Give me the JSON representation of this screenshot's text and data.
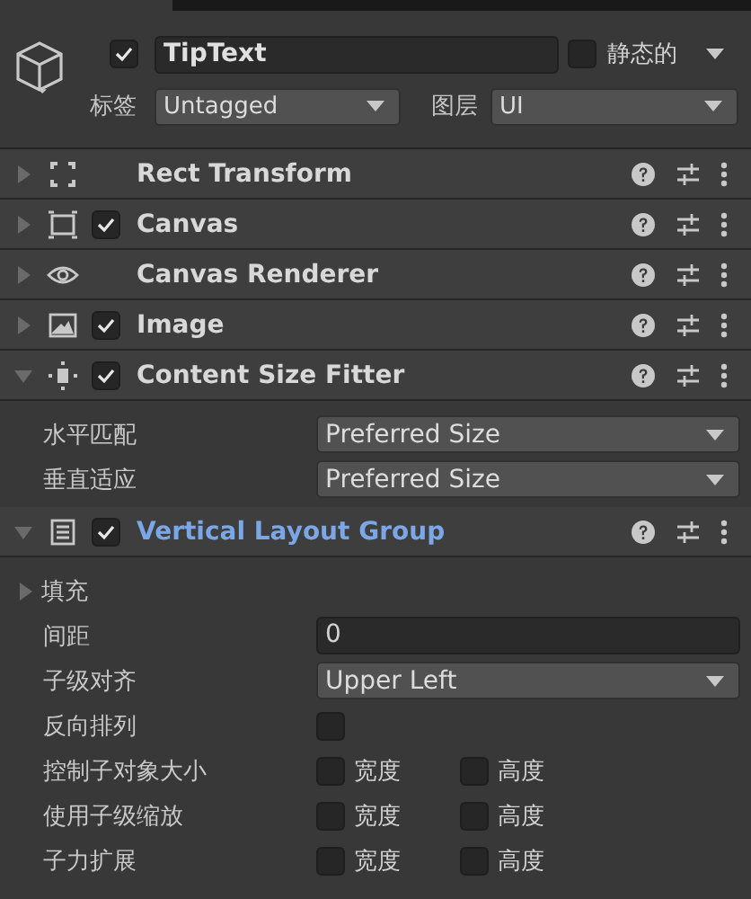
{
  "object": {
    "active": true,
    "name": "TipText",
    "static": false,
    "static_label": "静态的",
    "tag_label": "标签",
    "tag": "Untagged",
    "layer_label": "图层",
    "layer": "UI"
  },
  "components": [
    {
      "title": "Rect Transform",
      "expanded": false,
      "selected": false
    },
    {
      "title": "Canvas",
      "enabled": true,
      "expanded": false,
      "selected": false
    },
    {
      "title": "Canvas Renderer",
      "expanded": false,
      "selected": false
    },
    {
      "title": "Image",
      "enabled": true,
      "expanded": false,
      "selected": false
    },
    {
      "title": "Content Size Fitter",
      "enabled": true,
      "expanded": true,
      "selected": false,
      "properties": [
        {
          "kind": "dropdown",
          "label": "水平匹配",
          "value": "Preferred Size"
        },
        {
          "kind": "dropdown",
          "label": "垂直适应",
          "value": "Preferred Size"
        }
      ]
    },
    {
      "title": "Vertical Layout Group",
      "enabled": true,
      "expanded": true,
      "selected": true,
      "properties": [
        {
          "kind": "foldout",
          "label": "填充",
          "expanded": false
        },
        {
          "kind": "number",
          "label": "间距",
          "value": "0"
        },
        {
          "kind": "dropdown",
          "label": "子级对齐",
          "value": "Upper Left"
        },
        {
          "kind": "checkbox",
          "label": "反向排列",
          "checked": false
        },
        {
          "kind": "pair",
          "label": "控制子对象大小",
          "options": [
            {
              "label": "宽度",
              "checked": false
            },
            {
              "label": "高度",
              "checked": false
            }
          ]
        },
        {
          "kind": "pair",
          "label": "使用子级缩放",
          "options": [
            {
              "label": "宽度",
              "checked": false
            },
            {
              "label": "高度",
              "checked": false
            }
          ]
        },
        {
          "kind": "pair",
          "label": "子力扩展",
          "options": [
            {
              "label": "宽度",
              "checked": false
            },
            {
              "label": "高度",
              "checked": false
            }
          ]
        }
      ]
    }
  ]
}
